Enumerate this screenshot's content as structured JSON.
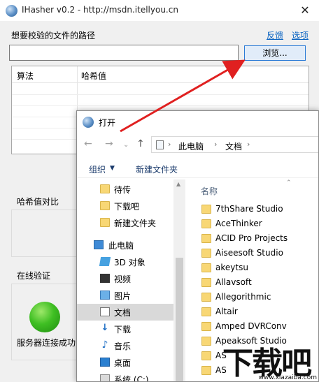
{
  "app": {
    "title": "IHasher v0.2 - http://msdn.itellyou.cn",
    "close_glyph": "✕"
  },
  "main": {
    "path_label": "想要校验的文件的路径",
    "feedback_link": "反馈",
    "options_link": "选项",
    "path_value": "",
    "browse_label": "浏览...",
    "table": {
      "columns": [
        "算法",
        "哈希值"
      ]
    },
    "compare_label": "哈希值对比",
    "online_label": "在线验证",
    "server_status": "服务器连接成功"
  },
  "dialog": {
    "title": "打开",
    "breadcrumb": [
      "此电脑",
      "文档"
    ],
    "organize_label": "组织",
    "new_folder_label": "新建文件夹",
    "nav_items": [
      {
        "label": "待传",
        "icon": "folder-icon"
      },
      {
        "label": "下载吧",
        "icon": "folder-icon"
      },
      {
        "label": "新建文件夹",
        "icon": "folder-icon"
      },
      {
        "label": "此电脑",
        "icon": "computer-icon"
      },
      {
        "label": "3D 对象",
        "icon": "3d-objects-icon"
      },
      {
        "label": "视频",
        "icon": "video-icon"
      },
      {
        "label": "图片",
        "icon": "pictures-icon"
      },
      {
        "label": "文档",
        "icon": "documents-icon",
        "selected": true
      },
      {
        "label": "下载",
        "icon": "download-icon"
      },
      {
        "label": "音乐",
        "icon": "music-icon"
      },
      {
        "label": "桌面",
        "icon": "desktop-icon"
      },
      {
        "label": "系统 (C:)",
        "icon": "drive-icon"
      }
    ],
    "name_column": "名称",
    "files": [
      "7thShare Studio",
      "AceThinker",
      "ACID Pro Projects",
      "Aiseesoft Studio",
      "akeytsu",
      "Allavsoft",
      "Allegorithmic",
      "Altair",
      "Amped DVRConv",
      "Apeaksoft Studio",
      "AS",
      "AS"
    ]
  },
  "watermark": {
    "text": "下载吧",
    "url": "www.xiazaiba.com"
  },
  "colors": {
    "link": "#0b64c2",
    "status_green": "#3fbf23",
    "arrow_red": "#e02020"
  }
}
